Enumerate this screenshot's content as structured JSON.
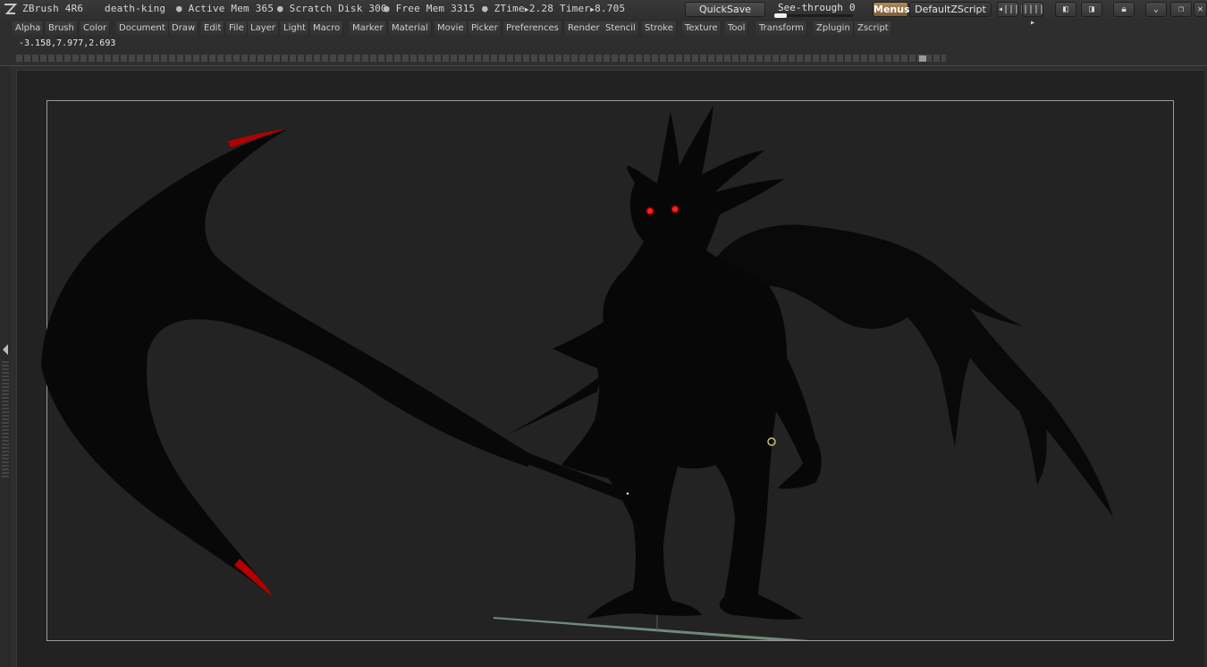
{
  "app": {
    "name": "ZBrush 4R6",
    "document": "death-king"
  },
  "stats": {
    "active_mem_label": "Active Mem",
    "active_mem": "365",
    "scratch_disk_label": "Scratch Disk",
    "scratch_disk": "300",
    "free_mem_label": "Free Mem",
    "free_mem": "3315",
    "ztime_label": "ZTime",
    "ztime": "2.28",
    "timer_label": "Timer",
    "timer": "8.705"
  },
  "toolbar": {
    "quicksave": "QuickSave",
    "see_through_label": "See-through",
    "see_through_value": "0",
    "see_through_level": 0,
    "menus": "Menus",
    "script": "DefaultZScript"
  },
  "menu": {
    "items": [
      "Alpha",
      "Brush",
      "Color",
      "Document",
      "Draw",
      "Edit",
      "File",
      "Layer",
      "Light",
      "Macro",
      "Marker",
      "Material",
      "Movie",
      "Picker",
      "Preferences",
      "Render",
      "Stencil",
      "Stroke",
      "Texture",
      "Tool",
      "Transform",
      "Zplugin",
      "Zscript"
    ]
  },
  "status": {
    "coords": "-3.158,7.977,2.693"
  },
  "colors": {
    "canvas_bg": "#222222",
    "silhouette": "#080808",
    "eye_glow": "#ff1a1a",
    "blade_edge": "#b00000",
    "ground_line": "#6f8a78",
    "menus_active": "#b08a5a"
  },
  "icons": [
    "zbrush-logo-icon",
    "scroll-left-icon",
    "scroll-right-icon",
    "layout-left-icon",
    "layout-right-icon",
    "lock-icon",
    "minimize-icon",
    "restore-icon",
    "close-icon"
  ]
}
